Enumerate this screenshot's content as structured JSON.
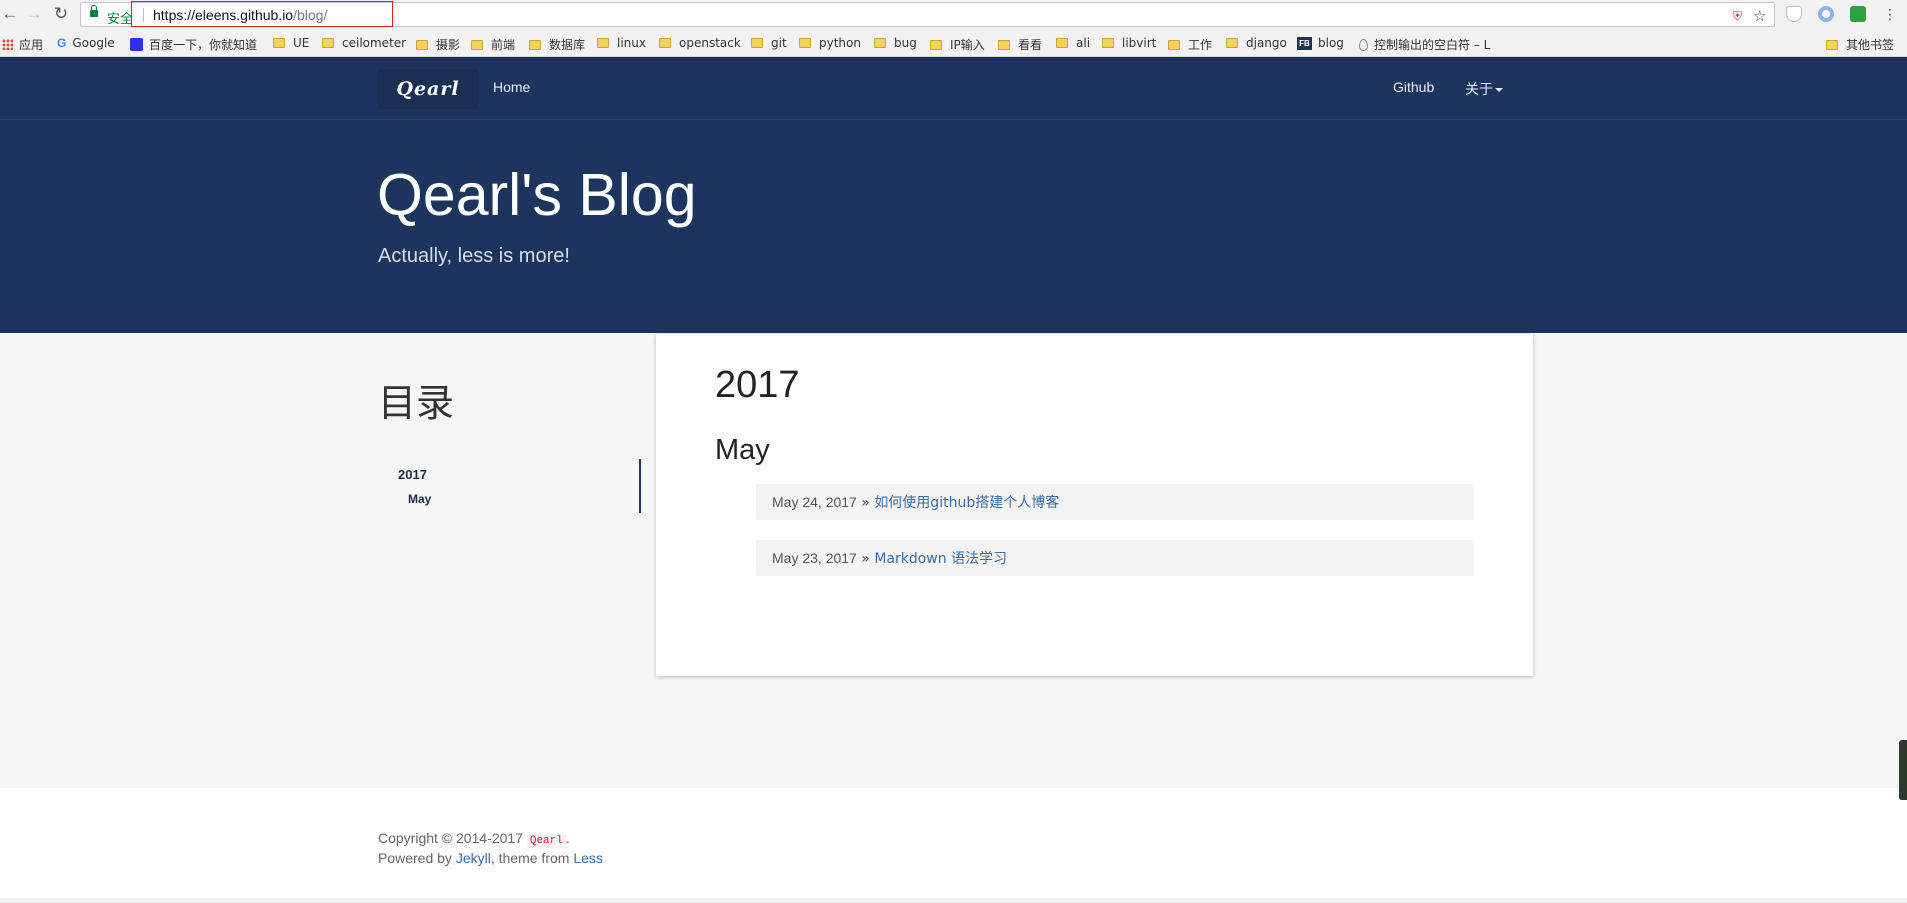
{
  "browser": {
    "secure_label": "安全",
    "url_host": "https://eleens.github.io",
    "url_path": "/blog/",
    "nav": {
      "back": "←",
      "forward": "→",
      "reload": "↻"
    },
    "omnibox_icons": {
      "shield": "shield-icon",
      "star": "☆"
    }
  },
  "bookmarks": {
    "apps": "应用",
    "items": [
      "Google",
      "百度一下，你就知道",
      "UE",
      "ceilometer",
      "摄影",
      "前端",
      "数据库",
      "linux",
      "openstack",
      "git",
      "python",
      "bug",
      "IP输入",
      "看看",
      "ali",
      "libvirt",
      "工作",
      "django",
      "blog",
      "控制输出的空白符 – L"
    ],
    "other": "其他书签"
  },
  "site": {
    "brand": "Qearl",
    "nav_home": "Home",
    "nav_github": "Github",
    "nav_about": "关于",
    "title": "Qearl's Blog",
    "subtitle": "Actually, less is more!",
    "accent": "#1d355e"
  },
  "sidebar": {
    "title": "目录",
    "year": "2017",
    "month": "May"
  },
  "archive": {
    "year": "2017",
    "month": "May",
    "posts": [
      {
        "date": "May 24, 2017",
        "sep": " » ",
        "title": "如何使用github搭建个人博客"
      },
      {
        "date": "May 23, 2017",
        "sep": " » ",
        "title": "Markdown 语法学习"
      }
    ]
  },
  "footer": {
    "copyright": "Copyright © 2014-2017 ",
    "author": "Qearl",
    "period": ".",
    "powered_by": "Powered by ",
    "jekyll": "Jekyll",
    "theme_from": ", theme from ",
    "less": "Less"
  }
}
